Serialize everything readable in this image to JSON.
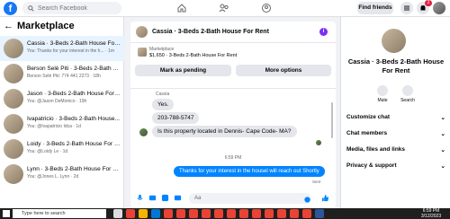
{
  "topbar": {
    "logo": "f",
    "search_placeholder": "Search Facebook",
    "find_friends": "Find friends",
    "notif_count": "2"
  },
  "left": {
    "header": "Marketplace",
    "threads": [
      {
        "title": "Cassia · 3-Beds 2-Bath House For Rent",
        "sub": "You: Thanks for your interest in the h... · 1m",
        "active": true
      },
      {
        "title": "Berson Selè Piti · 3-Beds 2-Bath H...",
        "sub": "Berson Selè Piti: 774 441 2273 · 18h",
        "active": false
      },
      {
        "title": "Jason · 3-Beds 2-Bath House For Rent",
        "sub": "You: @Jason DeMonico · 19h",
        "active": false
      },
      {
        "title": "Ivapatricio · 3-Beds 2-Bath House...",
        "sub": "You: @Ivapatricio Idca · 1d",
        "active": false
      },
      {
        "title": "Loidy · 3-Beds 2-Bath House For Rent",
        "sub": "You: @Loidy Le · 1d",
        "active": false
      },
      {
        "title": "Lynn · 3-Beds 2-Bath House For Re...",
        "sub": "You: @Jones L. Lynn · 2d",
        "active": false
      }
    ]
  },
  "chat": {
    "title": "Cassia · 3-Beds 2-Bath House For Rent",
    "marketplace_label": "Marketplace",
    "listing": "$1,650 · 3-Beds 2-Bath House For Rent",
    "mark_pending": "Mark as pending",
    "more_options": "More options",
    "sender": "Cassia",
    "msg1": "Yes.",
    "msg2": "203-788-5747",
    "msg3": "Is this property located in Dennis- Cape Code- MA?",
    "timestamp": "6:59 PM",
    "out_msg": "Thanks for your interest in the housel will reach out Shortly",
    "sent": "Sent",
    "composer_placeholder": "Aa"
  },
  "right": {
    "name": "Cassia · 3-Beds 2-Bath House For Rent",
    "mute": "Mute",
    "search": "Search",
    "rows": [
      "Customize chat",
      "Chat members",
      "Media, files and links",
      "Privacy & support"
    ]
  },
  "taskbar": {
    "search": "Type here to search",
    "time": "6:59 PM",
    "date": "3/12/2023"
  }
}
